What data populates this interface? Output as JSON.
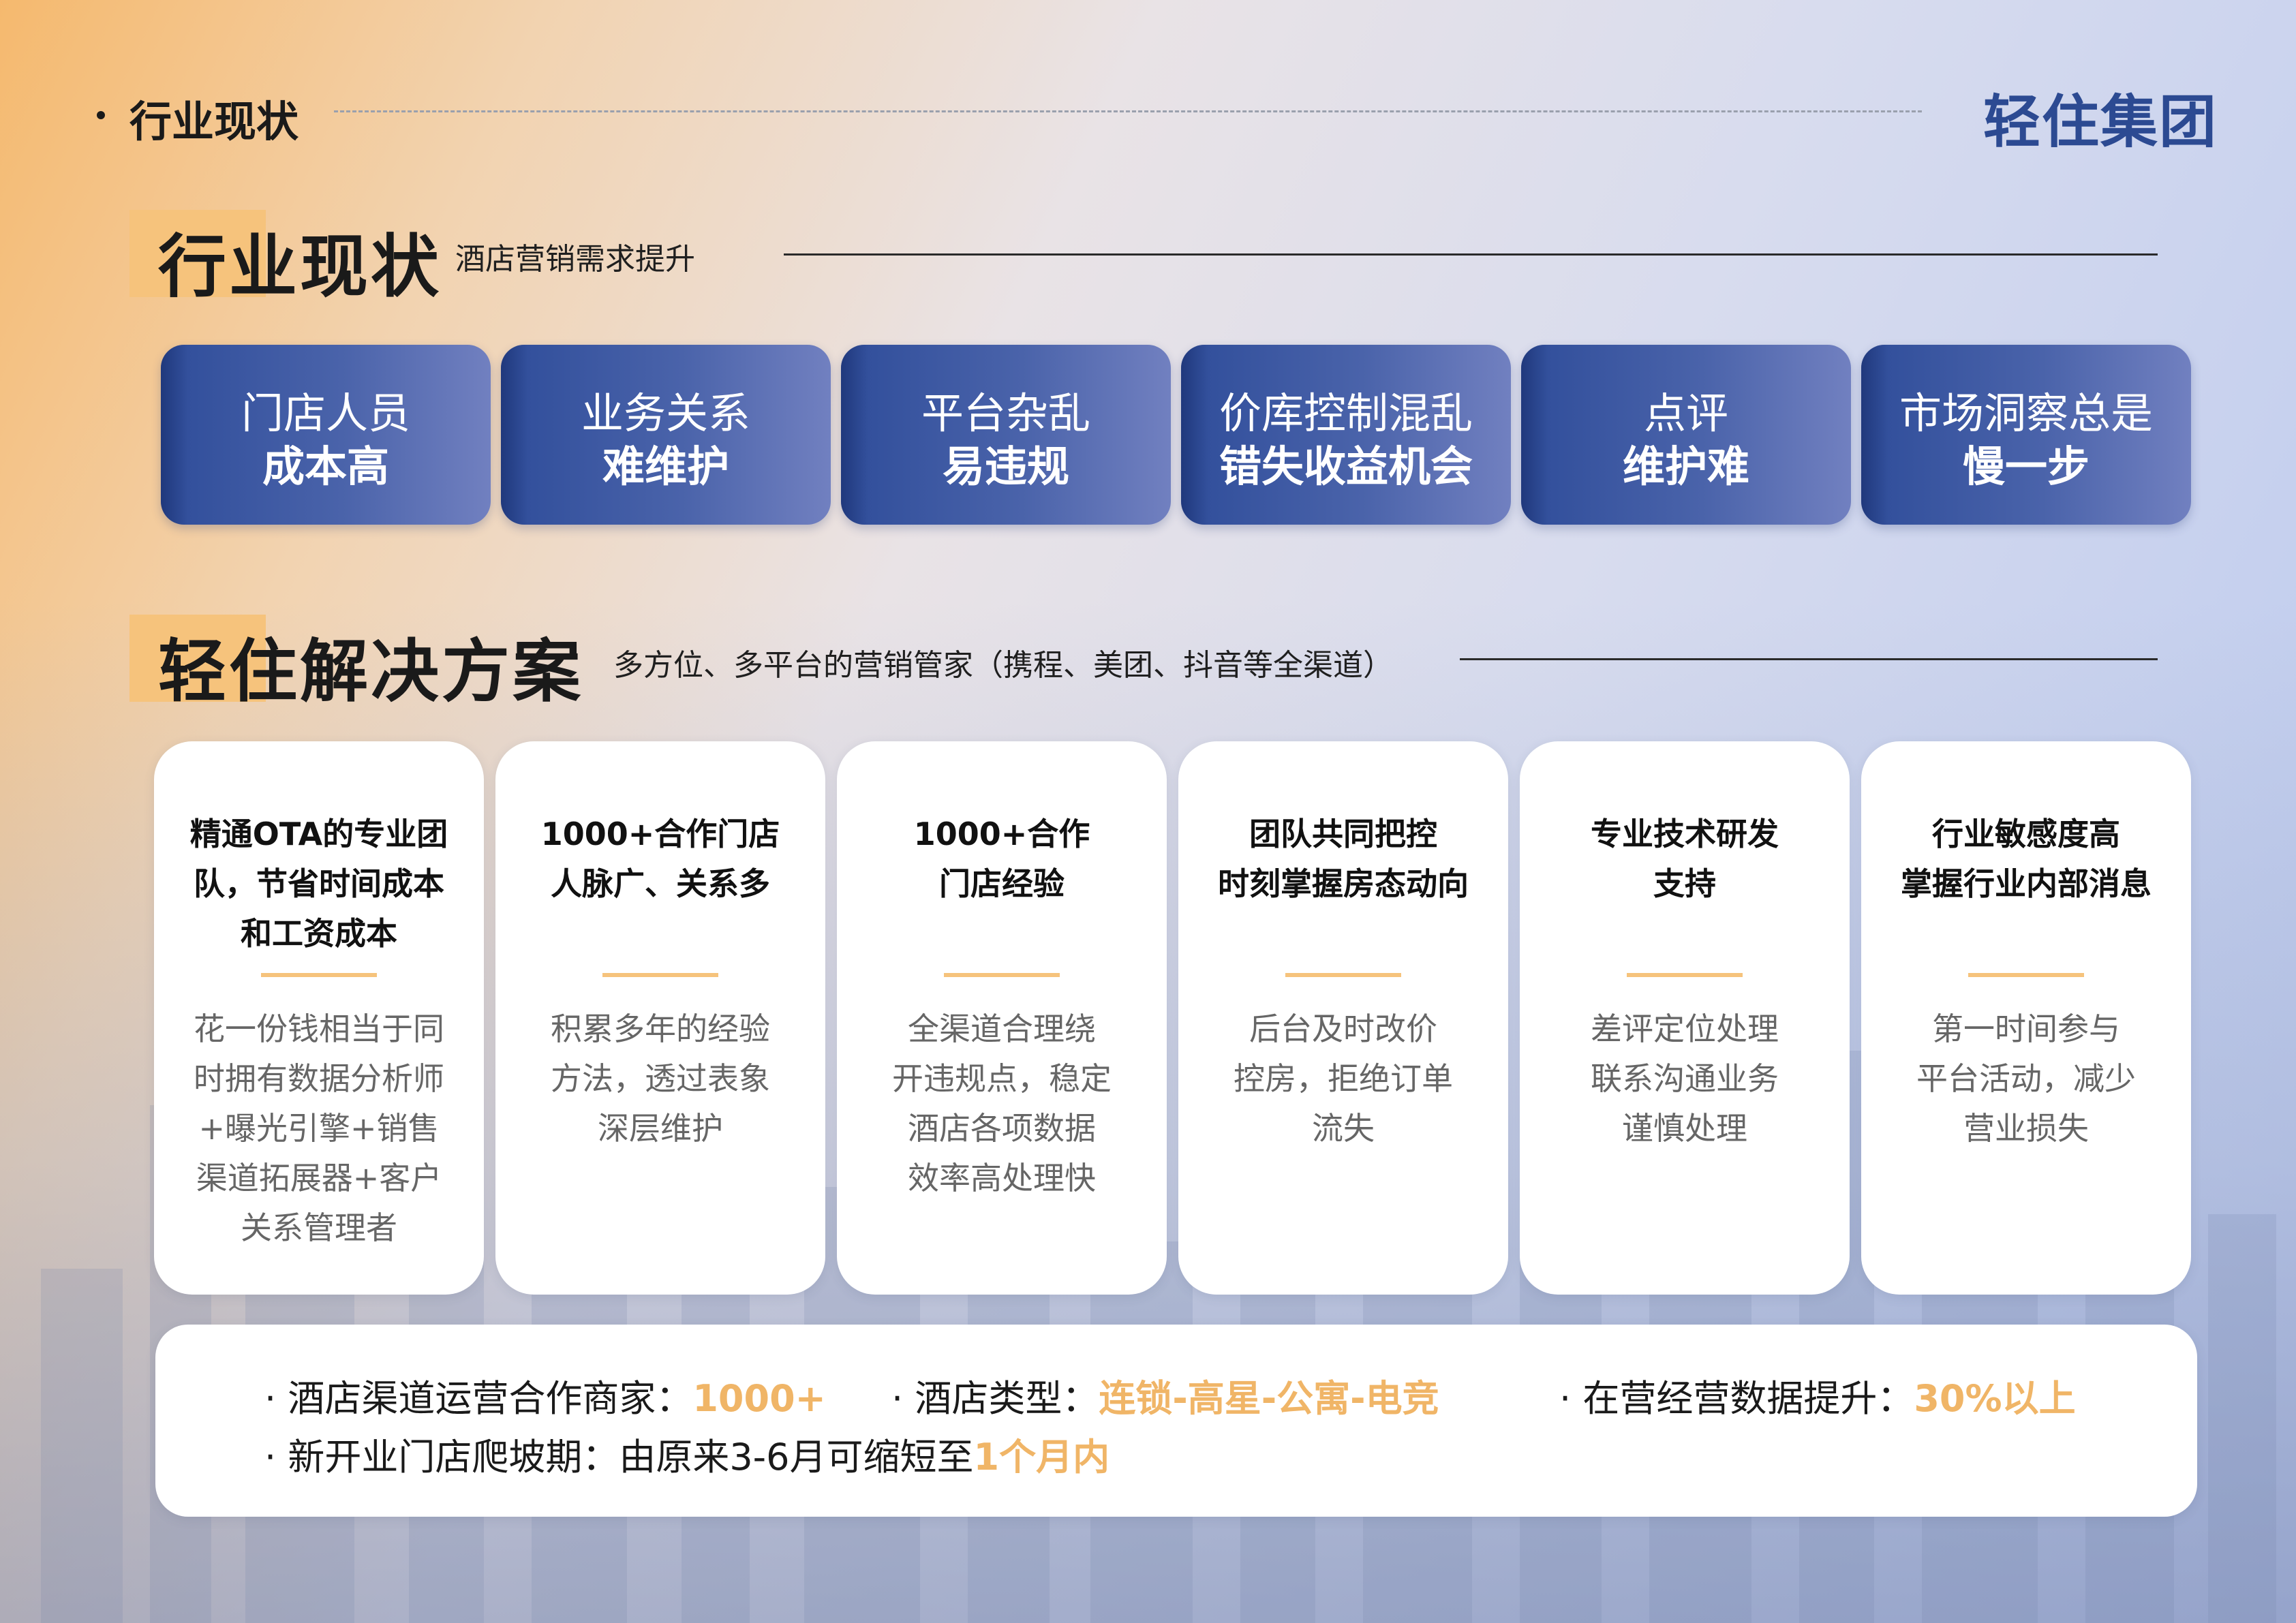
{
  "header": {
    "title": "行业现状",
    "logo": "轻住集团"
  },
  "section1": {
    "title": "行业现状",
    "subtitle": "酒店营销需求提升"
  },
  "problems": [
    {
      "line1": "门店人员",
      "line2": "成本高"
    },
    {
      "line1": "业务关系",
      "line2": "难维护"
    },
    {
      "line1": "平台杂乱",
      "line2": "易违规"
    },
    {
      "line1": "价库控制混乱",
      "line2": "错失收益机会"
    },
    {
      "line1": "点评",
      "line2": "维护难"
    },
    {
      "line1": "市场洞察总是",
      "line2": "慢一步"
    }
  ],
  "section2": {
    "title": "轻住解决方案",
    "subtitle": "多方位、多平台的营销管家（携程、美团、抖音等全渠道）"
  },
  "solutions": [
    {
      "head": [
        "精通OTA的专业团",
        "队，节省时间成本",
        "和工资成本"
      ],
      "body": [
        "花一份钱相当于同",
        "时拥有数据分析师",
        "+曝光引擎+销售",
        "渠道拓展器+客户",
        "关系管理者"
      ]
    },
    {
      "head": [
        "1000+合作门店",
        "人脉广、关系多"
      ],
      "body": [
        "积累多年的经验",
        "方法，透过表象",
        "深层维护"
      ]
    },
    {
      "head": [
        "1000+合作",
        "门店经验"
      ],
      "body": [
        "全渠道合理绕",
        "开违规点，稳定",
        "酒店各项数据",
        "效率高处理快"
      ]
    },
    {
      "head": [
        "团队共同把控",
        "时刻掌握房态动向"
      ],
      "body": [
        "后台及时改价",
        "控房，拒绝订单",
        "流失"
      ]
    },
    {
      "head": [
        "专业技术研发",
        "支持"
      ],
      "body": [
        "差评定位处理",
        "联系沟通业务",
        "谨慎处理"
      ]
    },
    {
      "head": [
        "行业敏感度高",
        "掌握行业内部消息"
      ],
      "body": [
        "第一时间参与",
        "平台活动，减少",
        "营业损失"
      ]
    }
  ],
  "stats": [
    {
      "label": "· 酒店渠道运营合作商家：",
      "value": "1000+"
    },
    {
      "label": "· 酒店类型：",
      "value": "连锁-高星-公寓-电竞"
    },
    {
      "label": "· 在营经营数据提升：",
      "value": "30%以上"
    },
    {
      "label": "· 新开业门店爬坡期：由原来3-6月可缩短至",
      "value": "1个月内"
    }
  ],
  "colors": {
    "accent": "#f6c37c",
    "card_blue": "#3a55a0",
    "brand": "#2c4a92",
    "highlight": "#f0b567"
  }
}
